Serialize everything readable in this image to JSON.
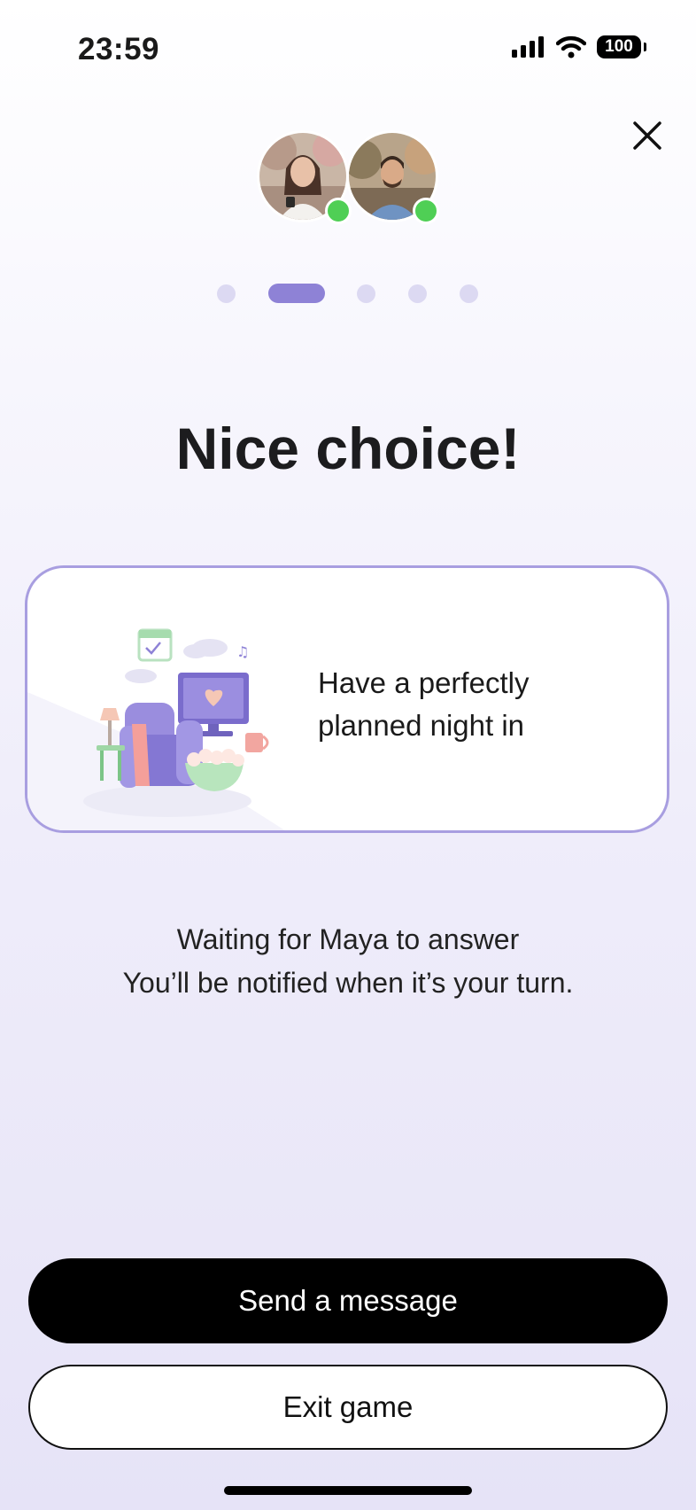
{
  "status_bar": {
    "time": "23:59",
    "battery": "100",
    "icons": [
      "signal-icon",
      "wifi-icon",
      "battery-icon"
    ]
  },
  "header": {
    "close_icon": "close-icon",
    "avatars": [
      {
        "name": "avatar-woman",
        "online": true
      },
      {
        "name": "avatar-man",
        "online": true
      }
    ],
    "pager": {
      "total": 5,
      "active_index": 1
    }
  },
  "main": {
    "title": "Nice choice!",
    "choice": {
      "text_line1": "Have a perfectly",
      "text_line2": "planned night in",
      "illustration": "night-in-illustration"
    },
    "waiting_line1": "Waiting for Maya to answer",
    "waiting_line2": "You’ll be notified when it’s your turn."
  },
  "actions": {
    "send_message": "Send a message",
    "exit_game": "Exit game"
  },
  "colors": {
    "accent": "#8e82d6",
    "card_border": "#a89ee0",
    "online": "#4fcf55",
    "primary_button": "#000000"
  }
}
